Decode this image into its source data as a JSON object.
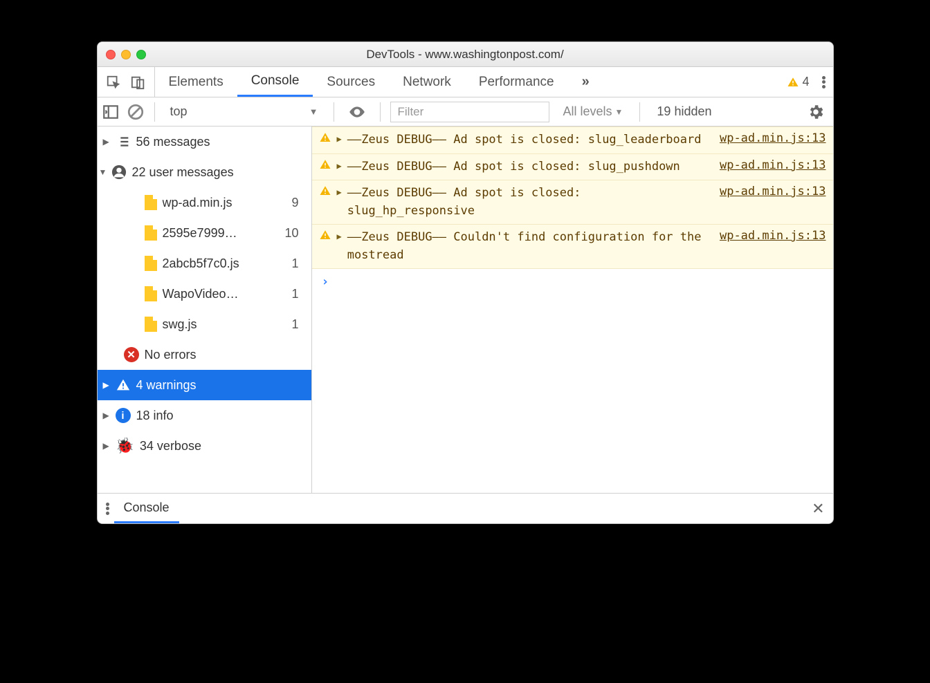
{
  "window": {
    "title": "DevTools - www.washingtonpost.com/"
  },
  "tabs": {
    "items": [
      "Elements",
      "Console",
      "Sources",
      "Network",
      "Performance"
    ],
    "active": "Console",
    "overflow": "»",
    "warn_badge": "4"
  },
  "toolbar": {
    "context": "top",
    "filter_placeholder": "Filter",
    "levels_label": "All levels",
    "hidden_label": "19 hidden"
  },
  "sidebar": {
    "messages": {
      "label": "56 messages"
    },
    "user_messages": {
      "label": "22 user messages"
    },
    "files": [
      {
        "name": "wp-ad.min.js",
        "count": "9"
      },
      {
        "name": "2595e7999…",
        "count": "10"
      },
      {
        "name": "2abcb5f7c0.js",
        "count": "1"
      },
      {
        "name": "WapoVideo…",
        "count": "1"
      },
      {
        "name": "swg.js",
        "count": "1"
      }
    ],
    "errors": {
      "label": "No errors"
    },
    "warnings": {
      "label": "4 warnings"
    },
    "info": {
      "label": "18 info"
    },
    "verbose": {
      "label": "34 verbose"
    }
  },
  "logs": [
    {
      "msg": "––Zeus DEBUG–– Ad spot is closed: slug_leaderboard",
      "src": "wp-ad.min.js:13"
    },
    {
      "msg": "––Zeus DEBUG–– Ad spot is closed: slug_pushdown",
      "src": "wp-ad.min.js:13"
    },
    {
      "msg": "––Zeus DEBUG–– Ad spot is closed: slug_hp_responsive",
      "src": "wp-ad.min.js:13"
    },
    {
      "msg": "––Zeus DEBUG–– Couldn't find configuration for the mostread",
      "src": "wp-ad.min.js:13"
    }
  ],
  "drawer": {
    "tab": "Console"
  }
}
